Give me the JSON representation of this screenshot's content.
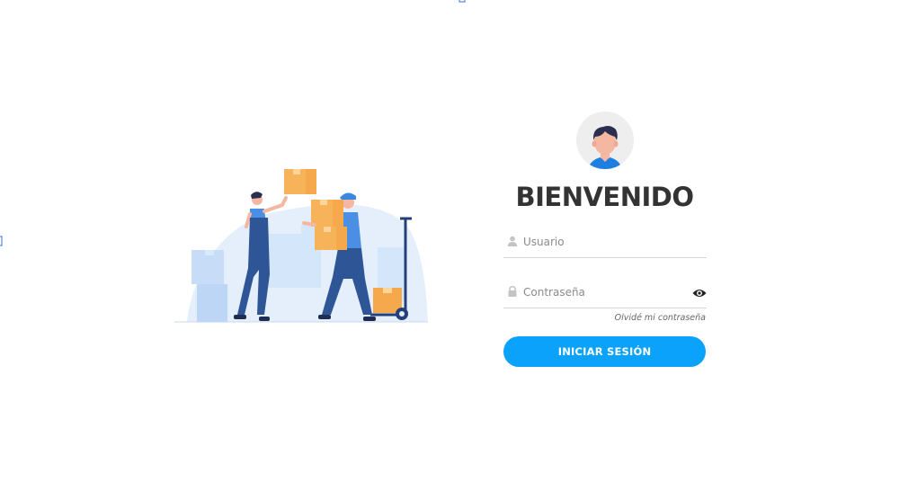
{
  "colors": {
    "accent": "#0aa2fb",
    "title": "#333333",
    "box_orange": "#f5a94c",
    "worker_blue": "#2e5596"
  },
  "illustration": {
    "description_icon": "delivery-workers-illustration-icon"
  },
  "login": {
    "avatar_icon": "user-avatar-icon",
    "title": "BIENVENIDO",
    "username": {
      "icon": "user-icon",
      "placeholder": "Usuario",
      "value": ""
    },
    "password": {
      "icon": "lock-icon",
      "placeholder": "Contraseña",
      "value": "",
      "toggle_icon": "eye-icon"
    },
    "forgot_label": "Olvidé mi contraseña",
    "submit_label": "INICIAR SESIÓN"
  }
}
